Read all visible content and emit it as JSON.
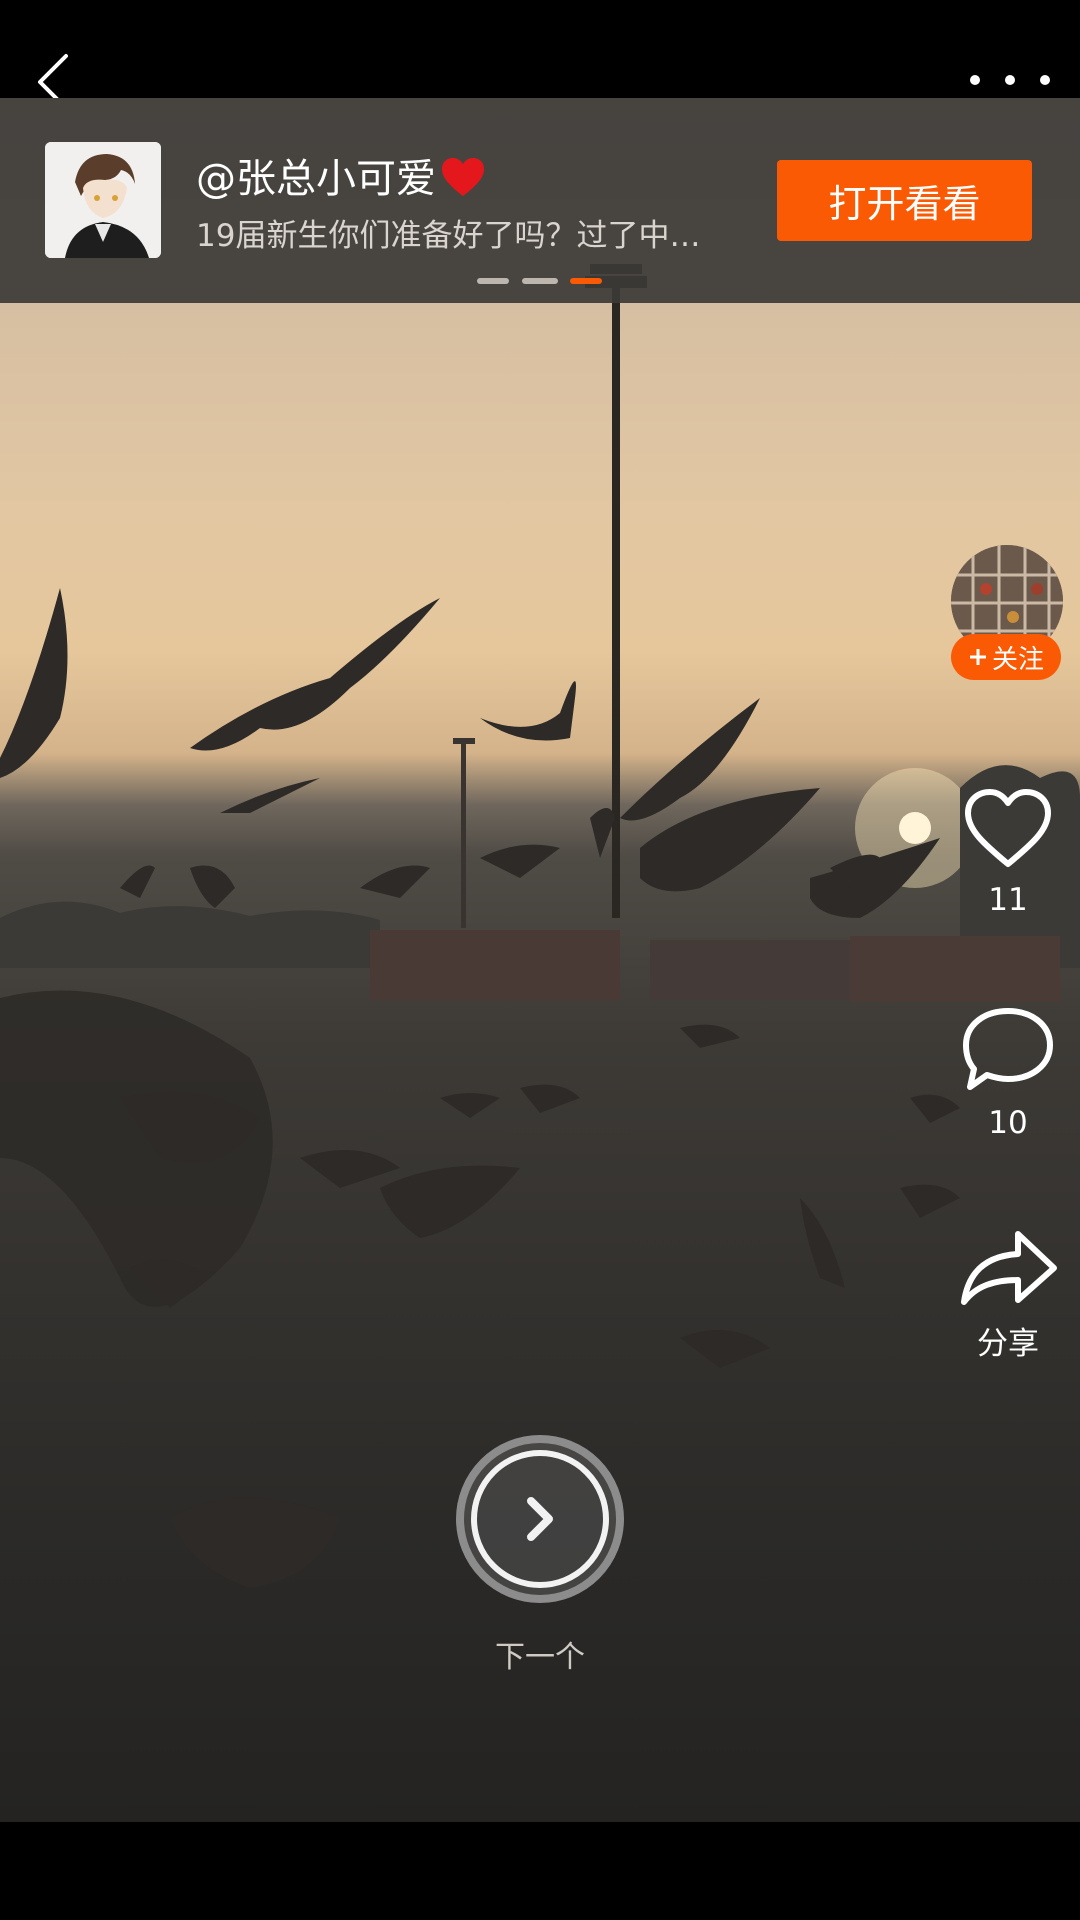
{
  "banner": {
    "username": "@张总小可爱",
    "caption": "19届新生你们准备好了吗？过了中…",
    "open_label": "打开看看",
    "page_count": 3,
    "active_page": 3
  },
  "sidebar": {
    "follow_label": "关注",
    "likes": "11",
    "comments": "10",
    "share_label": "分享"
  },
  "next": {
    "label": "下一个"
  },
  "colors": {
    "accent": "#fb5a05"
  },
  "icons": [
    "back-icon",
    "more-icon",
    "heart-icon",
    "comment-icon",
    "share-icon",
    "next-arrow-icon",
    "heart-emoji-icon",
    "plus-icon"
  ]
}
